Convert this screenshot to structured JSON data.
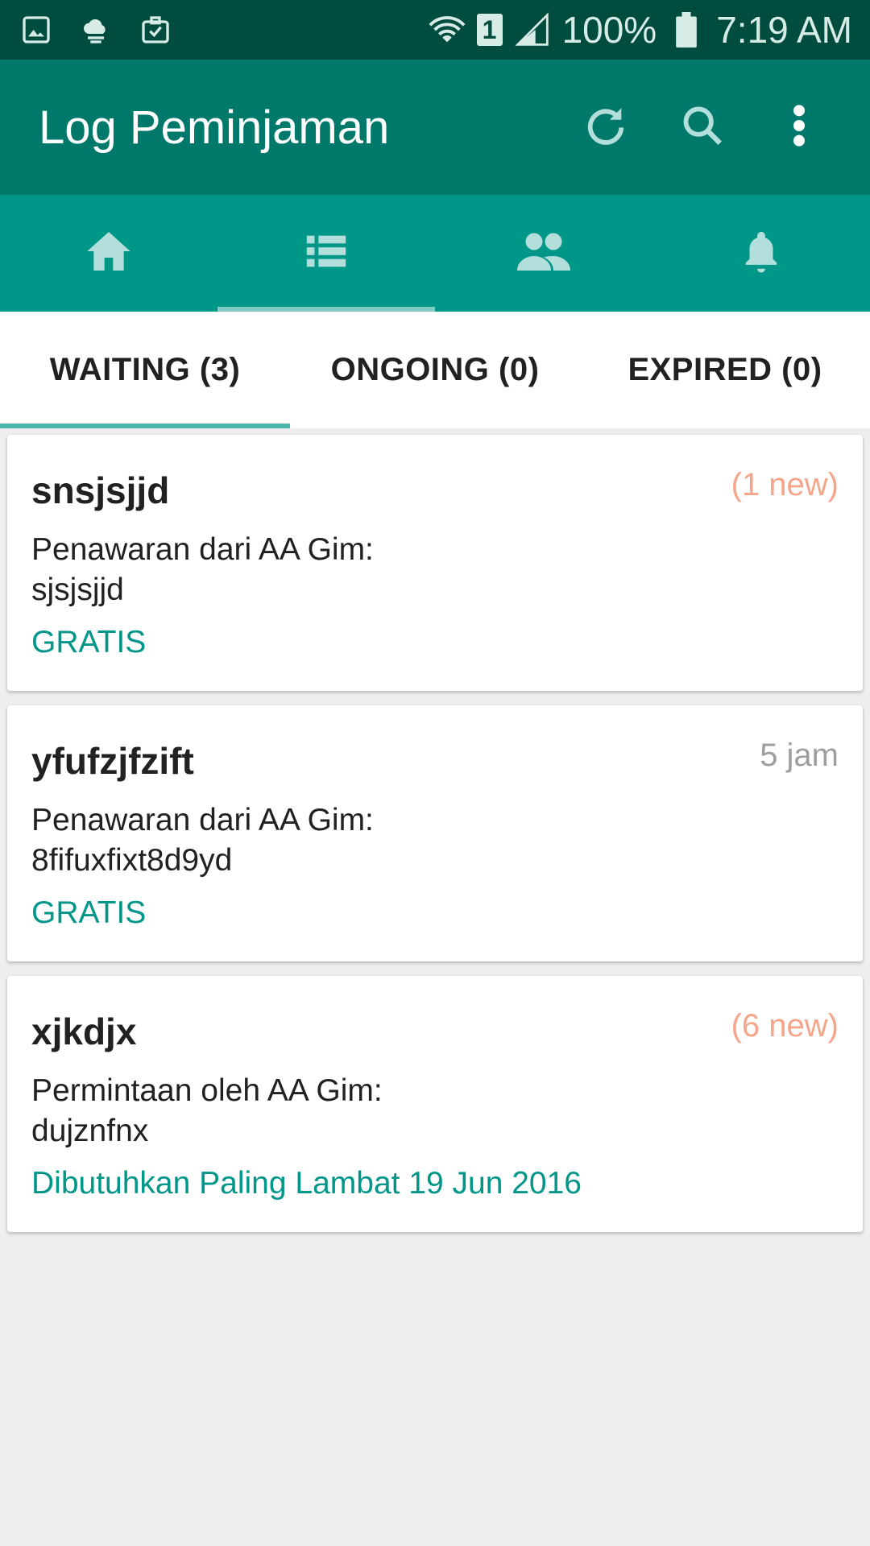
{
  "status_bar": {
    "battery": "100%",
    "time": "7:19 AM",
    "sim": "1"
  },
  "app_bar": {
    "title": "Log Peminjaman",
    "icons": [
      "refresh-icon",
      "search-icon",
      "more-vert-icon"
    ]
  },
  "nav": {
    "items": [
      "home-icon",
      "list-icon",
      "people-icon",
      "bell-icon"
    ],
    "active_index": 1
  },
  "tabs": [
    {
      "label": "WAITING (3)",
      "active": true
    },
    {
      "label": "ONGOING (0)",
      "active": false
    },
    {
      "label": "EXPIRED (0)",
      "active": false
    }
  ],
  "items": [
    {
      "title": "snsjsjjd",
      "meta": "(1 new)",
      "desc_line1": "Penawaran dari AA Gim:",
      "desc_line2": "sjsjsjjd",
      "price": "GRATIS"
    },
    {
      "title": "yfufzjfzift",
      "meta": "5 jam",
      "desc_line1": "Penawaran dari AA Gim:",
      "desc_line2": "8fifuxfixt8d9yd",
      "price": "GRATIS"
    },
    {
      "title": "xjkdjx",
      "meta": "(6 new)",
      "desc_line1": "Permintaan oleh AA Gim:",
      "desc_line2": "dujznfnx",
      "price": "Dibutuhkan Paling Lambat 19 Jun 2016"
    }
  ],
  "colors": {
    "status_bar": "#004d40",
    "app_bar": "#00796b",
    "nav_bar": "#009688",
    "accent": "#00968a",
    "new_badge": "#f4a58a"
  }
}
